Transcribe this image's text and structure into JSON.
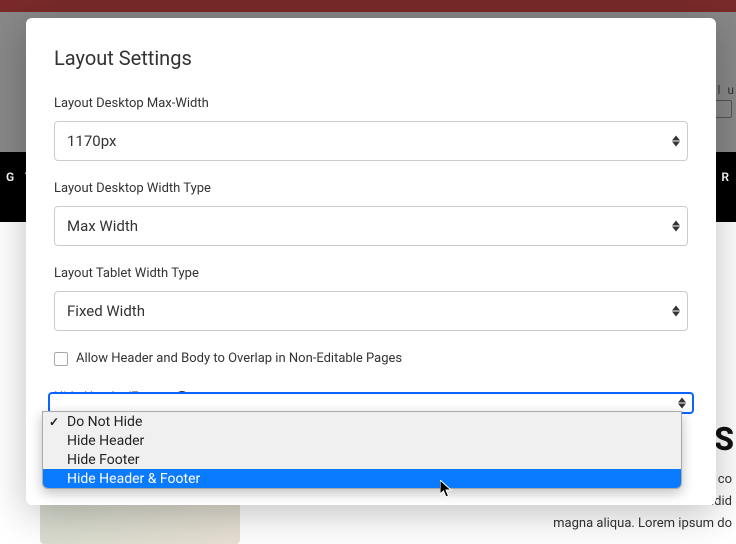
{
  "background": {
    "navLeft": "G  T",
    "navRight": "O R",
    "sideText": "l l  u",
    "heading": "S S",
    "paragraph1": "co",
    "paragraph2": "idid",
    "paragraph3": "magna aliqua. Lorem ipsum do"
  },
  "modal": {
    "title": "Layout Settings",
    "fields": {
      "desktopMaxWidth": {
        "label": "Layout Desktop Max-Width",
        "value": "1170px"
      },
      "desktopWidthType": {
        "label": "Layout Desktop Width Type",
        "value": "Max Width"
      },
      "tabletWidthType": {
        "label": "Layout Tablet Width Type",
        "value": "Fixed Width"
      },
      "overlapCheckbox": {
        "label": "Allow Header and Body to Overlap in Non-Editable Pages",
        "checked": false
      },
      "hideHeaderFooter": {
        "label": "Hide Header/Footer",
        "options": [
          "Do Not Hide",
          "Hide Header",
          "Hide Footer",
          "Hide Header & Footer"
        ],
        "selectedIndex": 0,
        "highlightedIndex": 3
      }
    }
  }
}
